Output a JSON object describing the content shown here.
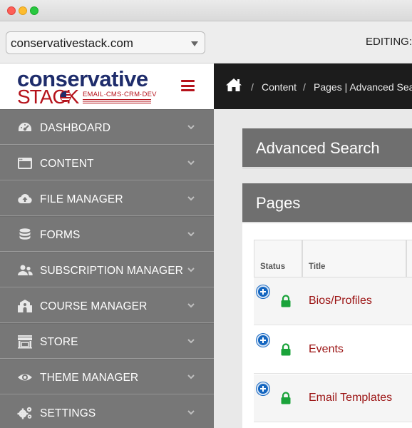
{
  "window": {
    "controls": [
      "close",
      "minimize",
      "zoom"
    ]
  },
  "topbar": {
    "site_select_value": "conservativestack.com",
    "editing_label": "EDITING:"
  },
  "logo": {
    "line1": "conservative",
    "line2": "STACK",
    "tagline": "EMAIL·CMS·CRM·DEV",
    "brand_blue": "#1e2c6b",
    "brand_red": "#b5121b"
  },
  "breadcrumb": {
    "home_icon": "home-icon",
    "items": [
      "Content",
      "Pages | Advanced Search"
    ]
  },
  "sidebar": {
    "items": [
      {
        "label": "DASHBOARD",
        "icon": "gauge-icon"
      },
      {
        "label": "CONTENT",
        "icon": "browser-window-icon"
      },
      {
        "label": "FILE MANAGER",
        "icon": "cloud-upload-icon"
      },
      {
        "label": "FORMS",
        "icon": "database-icon"
      },
      {
        "label": "SUBSCRIPTION MANAGER",
        "icon": "users-icon"
      },
      {
        "label": "COURSE MANAGER",
        "icon": "school-icon"
      },
      {
        "label": "STORE",
        "icon": "storefront-icon"
      },
      {
        "label": "THEME MANAGER",
        "icon": "eye-icon"
      },
      {
        "label": "SETTINGS",
        "icon": "gears-icon"
      }
    ]
  },
  "main": {
    "advanced_search_title": "Advanced Search",
    "pages_title": "Pages",
    "table": {
      "columns": [
        "Status",
        "Title"
      ],
      "rows": [
        {
          "title": "Bios/Profiles",
          "status": "locked"
        },
        {
          "title": "Events",
          "status": "locked"
        },
        {
          "title": "Email Templates",
          "status": "locked"
        }
      ]
    }
  },
  "colors": {
    "sidebar": "#777777",
    "breadcrumb_bar": "#1c1c1c",
    "link_red": "#9b1313",
    "lock_green": "#1aa33a",
    "expand_blue": "#1466c0"
  }
}
